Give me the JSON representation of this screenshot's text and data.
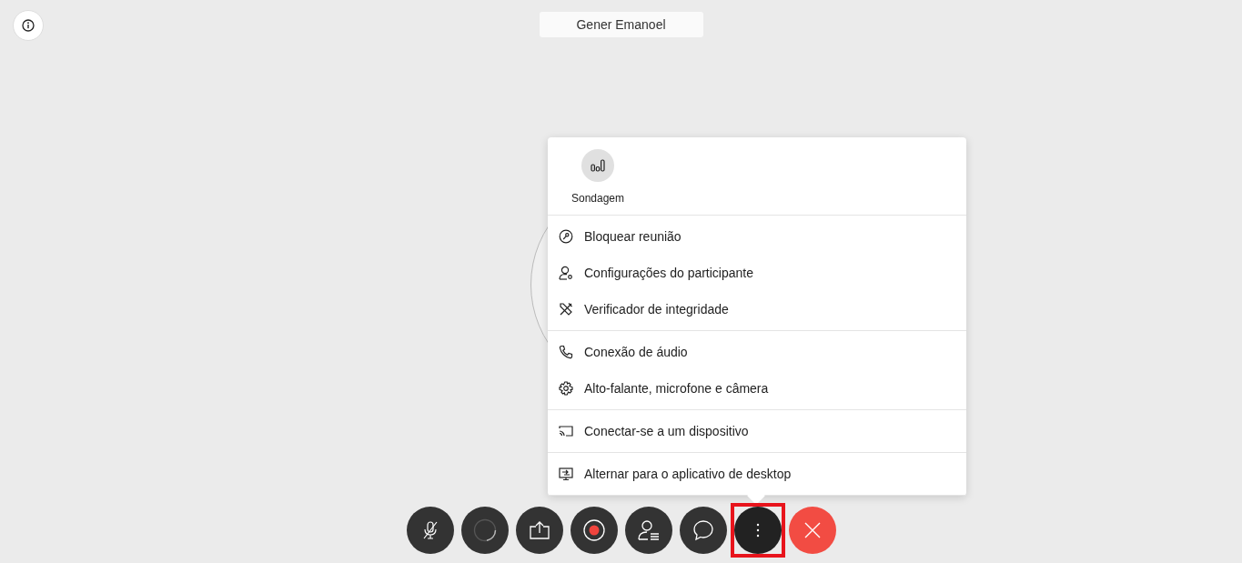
{
  "name_tag": "Gener Emanoel",
  "menu": {
    "quick_actions": [
      {
        "kind": "poll",
        "label": "Sondagem"
      }
    ],
    "sections": [
      [
        {
          "kind": "lock",
          "label": "Bloquear reunião"
        },
        {
          "kind": "participant-settings",
          "label": "Configurações do participante"
        },
        {
          "kind": "tools",
          "label": "Verificador de integridade"
        }
      ],
      [
        {
          "kind": "phone",
          "label": "Conexão de áudio"
        },
        {
          "kind": "gear",
          "label": "Alto-falante, microfone e câmera"
        }
      ],
      [
        {
          "kind": "cast",
          "label": "Conectar-se a um dispositivo"
        }
      ],
      [
        {
          "kind": "desktop",
          "label": "Alternar para o aplicativo de desktop"
        }
      ]
    ]
  },
  "toolbar": [
    {
      "kind": "mic-muted",
      "selected": false
    },
    {
      "kind": "video-loading",
      "selected": false
    },
    {
      "kind": "share",
      "selected": false
    },
    {
      "kind": "record",
      "selected": false
    },
    {
      "kind": "participants",
      "selected": false
    },
    {
      "kind": "chat",
      "selected": false
    },
    {
      "kind": "more",
      "selected": true
    },
    {
      "kind": "leave",
      "selected": false
    }
  ]
}
